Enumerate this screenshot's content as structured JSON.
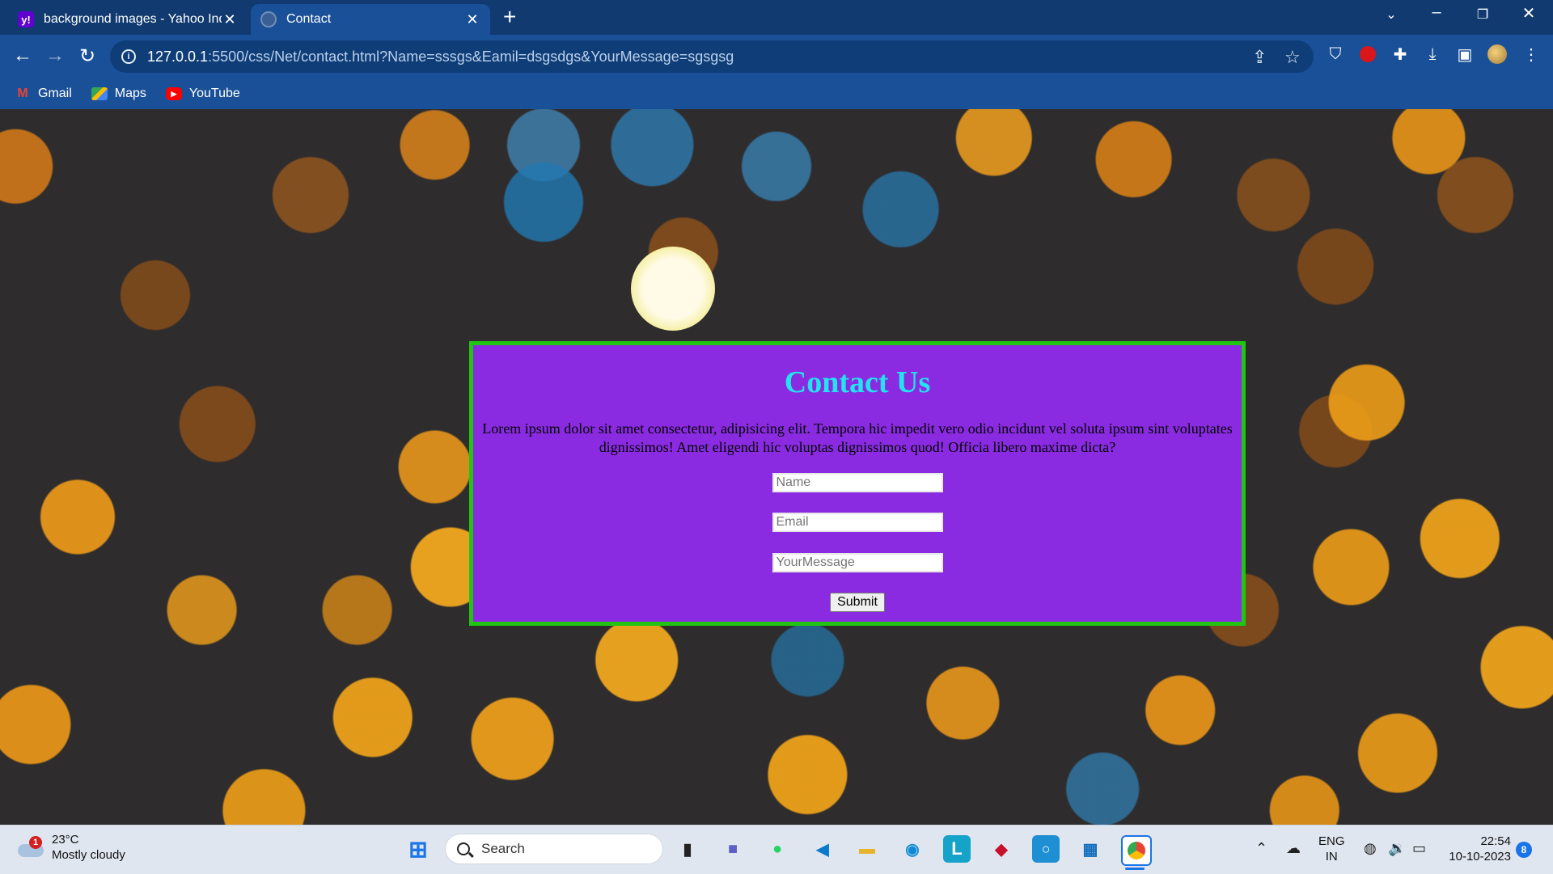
{
  "browser": {
    "tabs": [
      {
        "title": "background images - Yahoo Ind",
        "favicon": "yahoo-icon",
        "active": false
      },
      {
        "title": "Contact",
        "favicon": "globe-icon",
        "active": true
      }
    ],
    "new_tab_glyph": "+",
    "url_host": "127.0.0.1",
    "url_rest": ":5500/css/Net/contact.html?Name=sssgs&Eamil=dsgsdgs&YourMessage=sgsgsg",
    "bookmarks": [
      {
        "label": "Gmail",
        "icon": "gmail-icon"
      },
      {
        "label": "Maps",
        "icon": "maps-icon"
      },
      {
        "label": "YouTube",
        "icon": "youtube-icon"
      }
    ]
  },
  "page": {
    "title": "Contact Us",
    "description": "Lorem ipsum dolor sit amet consectetur, adipisicing elit. Tempora hic impedit vero odio incidunt vel soluta ipsum sint voluptates dignissimos! Amet eligendi hic voluptas dignissimos quod! Officia libero maxime dicta?",
    "fields": [
      {
        "placeholder": "Name",
        "value": ""
      },
      {
        "placeholder": "Email",
        "value": ""
      },
      {
        "placeholder": "YourMessage",
        "value": ""
      }
    ],
    "submit_label": "Submit",
    "colors": {
      "panel_bg": "#8a2be2",
      "panel_border": "#22c414",
      "title": "#22e4ef"
    }
  },
  "taskbar": {
    "weather_temp": "23°C",
    "weather_desc": "Mostly cloudy",
    "weather_badge": "1",
    "search_label": "Search",
    "lang_top": "ENG",
    "lang_bottom": "IN",
    "time": "22:54",
    "date": "10-10-2023",
    "notification_count": "8"
  }
}
